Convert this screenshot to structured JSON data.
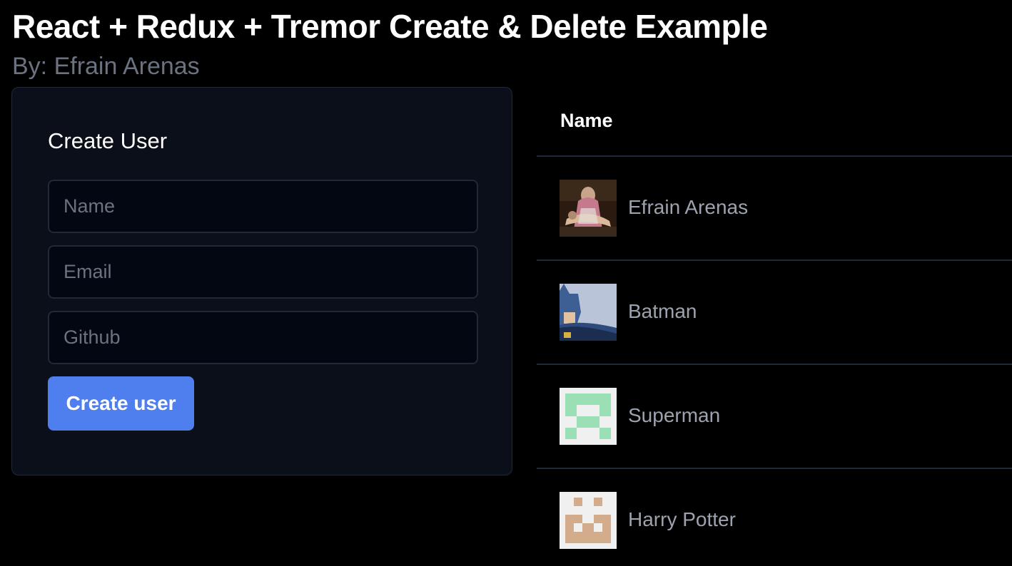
{
  "header": {
    "title": "React + Redux + Tremor Create & Delete Example",
    "subtitle": "By: Efrain Arenas"
  },
  "form": {
    "title": "Create User",
    "name_placeholder": "Name",
    "email_placeholder": "Email",
    "github_placeholder": "Github",
    "submit_label": "Create user",
    "accent_color": "#4f7fee"
  },
  "table": {
    "column_name": "Name",
    "rows": [
      {
        "name": "Efrain Arenas",
        "avatar": "painting-avatar"
      },
      {
        "name": "Batman",
        "avatar": "batman-avatar"
      },
      {
        "name": "Superman",
        "avatar": "green-identicon-avatar"
      },
      {
        "name": "Harry Potter",
        "avatar": "tan-identicon-avatar"
      }
    ]
  }
}
